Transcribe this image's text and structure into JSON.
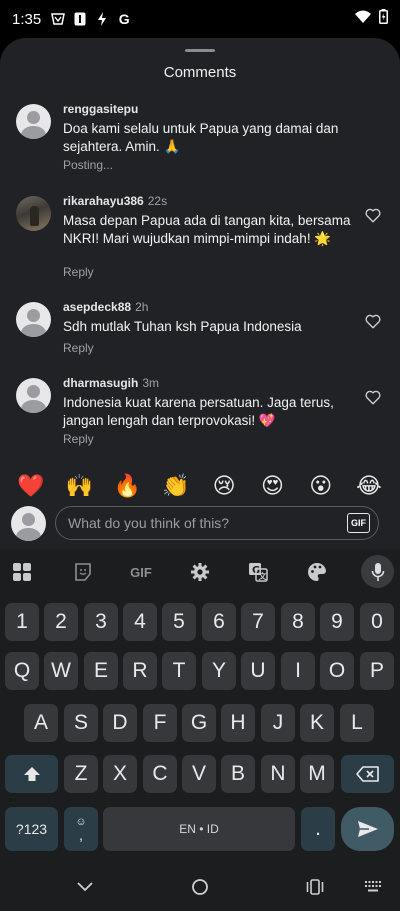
{
  "status_bar": {
    "time": "1:35"
  },
  "sheet": {
    "title": "Comments"
  },
  "comments": [
    {
      "user": "renggasitepu",
      "time": "",
      "text": "Doa kami selalu untuk Papua yang damai dan sejahtera. Amin. 🙏",
      "action": "Posting..."
    },
    {
      "user": "rikarahayu386",
      "time": "22s",
      "text": "Masa depan Papua ada di tangan kita, bersama NKRI! Mari wujudkan mimpi-mimpi indah! 🌟",
      "action": "Reply"
    },
    {
      "user": "asepdeck88",
      "time": "2h",
      "text": "Sdh mutlak Tuhan ksh Papua Indonesia",
      "action": "Reply"
    },
    {
      "user": "dharmasugih",
      "time": "3m",
      "text": "Indonesia kuat karena persatuan. Jaga terus, jangan lengah dan terprovokasi! 💖",
      "action": "Reply"
    }
  ],
  "emoji_bar": [
    "❤️",
    "🙌",
    "🔥",
    "👏",
    "😢",
    "😍",
    "😮",
    "😂"
  ],
  "composer": {
    "placeholder": "What do you think of this?",
    "gif_label": "GIF"
  },
  "keyboard": {
    "toolbar_gif": "GIF",
    "row_numbers": [
      "1",
      "2",
      "3",
      "4",
      "5",
      "6",
      "7",
      "8",
      "9",
      "0"
    ],
    "row_1": [
      "Q",
      "W",
      "E",
      "R",
      "T",
      "Y",
      "U",
      "I",
      "O",
      "P"
    ],
    "row_2": [
      "A",
      "S",
      "D",
      "F",
      "G",
      "H",
      "J",
      "K",
      "L"
    ],
    "row_3": [
      "Z",
      "X",
      "C",
      "V",
      "B",
      "N",
      "M"
    ],
    "symbols_key": "?123",
    "emoji_comma_key": ",",
    "space_label": "EN • ID",
    "period_key": "."
  }
}
